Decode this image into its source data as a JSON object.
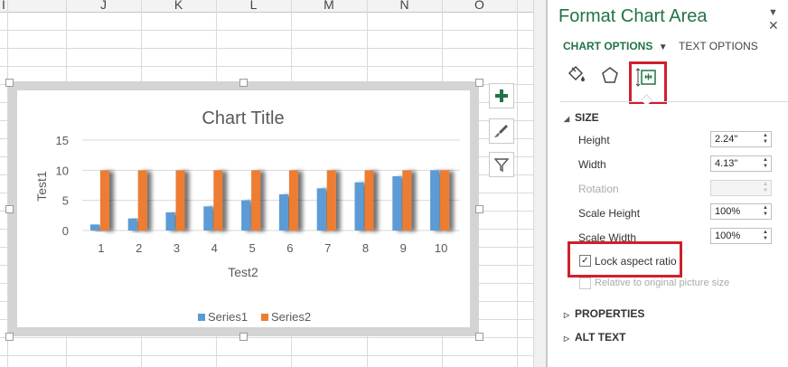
{
  "sheet": {
    "columns": [
      "I",
      "J",
      "K",
      "L",
      "M",
      "N",
      "O"
    ]
  },
  "chart": {
    "title": "Chart Title",
    "side_buttons": [
      "chart-elements-icon",
      "chart-styles-icon",
      "chart-filters-icon"
    ]
  },
  "chart_data": {
    "type": "bar",
    "title": "Chart Title",
    "xlabel": "Test2",
    "ylabel": "Test1",
    "categories": [
      "1",
      "2",
      "3",
      "4",
      "5",
      "6",
      "7",
      "8",
      "9",
      "10"
    ],
    "ylim": [
      0,
      15
    ],
    "yticks": [
      "0",
      "5",
      "10",
      "15"
    ],
    "grid": true,
    "legend": "bottom",
    "series": [
      {
        "name": "Series1",
        "color": "#5b9bd5",
        "values": [
          1,
          2,
          3,
          4,
          5,
          6,
          7,
          8,
          9,
          10
        ]
      },
      {
        "name": "Series2",
        "color": "#ed7d31",
        "values": [
          10,
          10,
          10,
          10,
          10,
          10,
          10,
          10,
          10,
          10
        ]
      }
    ]
  },
  "pane": {
    "title": "Format Chart Area",
    "tabs": {
      "chart_options": "CHART OPTIONS",
      "text_options": "TEXT OPTIONS"
    },
    "icon_tabs": [
      "fill-line-icon",
      "effects-icon",
      "size-properties-icon"
    ],
    "sections": {
      "size": "SIZE",
      "properties": "PROPERTIES",
      "alt_text": "ALT TEXT"
    },
    "size": {
      "height_label": "Height",
      "height_value": "2.24\"",
      "width_label": "Width",
      "width_value": "4.13\"",
      "rotation_label": "Rotation",
      "rotation_value": "",
      "scale_height_label": "Scale Height",
      "scale_height_value": "100%",
      "scale_width_label": "Scale Width",
      "scale_width_value": "100%",
      "lock_aspect_label": "Lock aspect ratio",
      "lock_aspect_checked": true,
      "relative_label": "Relative to original picture size",
      "relative_checked": false
    },
    "accent_color": "#217346",
    "highlight_color": "#d0202a"
  }
}
